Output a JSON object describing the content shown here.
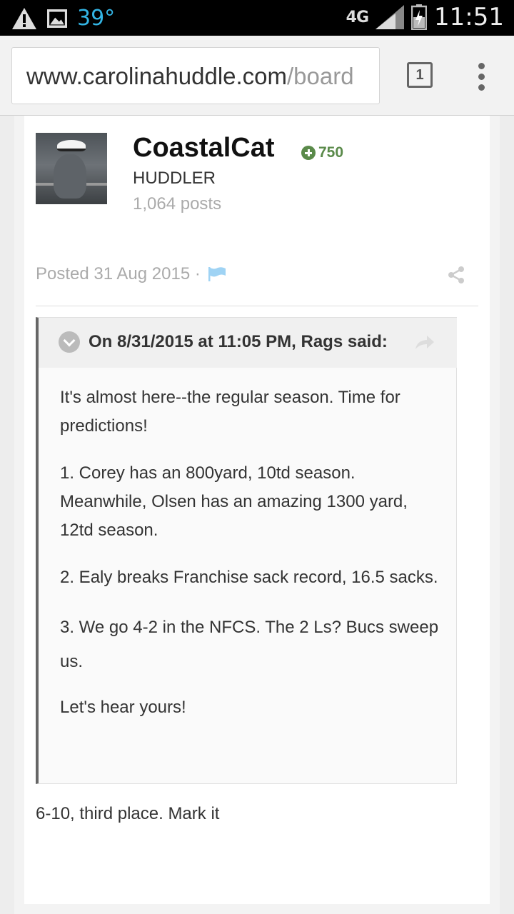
{
  "status_bar": {
    "temperature": "39°",
    "network": "4G",
    "time": "11:51"
  },
  "browser": {
    "url_domain": "www.carolinahuddle.com",
    "url_path": "/board",
    "tab_count": "1"
  },
  "post": {
    "author": {
      "username": "CoastalCat",
      "reputation": "750",
      "rank": "HUDDLER",
      "post_count": "1,064 posts"
    },
    "posted": "Posted 31 Aug 2015 ·",
    "quote": {
      "citation": "On 8/31/2015 at 11:05 PM, Rags said:",
      "paragraphs": [
        "It's almost here--the regular season. Time for predictions!",
        "1. Corey has an 800yard, 10td season. Meanwhile, Olsen has an amazing 1300 yard, 12td season.",
        "2. Ealy breaks Franchise sack record, 16.5 sacks.",
        "3. We go 4-2 in the NFCS. The 2 Ls? Bucs sweep us.",
        "Let's hear yours!"
      ]
    },
    "reply_text": "6-10, third place. Mark it"
  },
  "colors": {
    "reputation_green": "#5a8a4a",
    "temperature_blue": "#33b5e5",
    "flag_blue": "#9fd3f4"
  }
}
